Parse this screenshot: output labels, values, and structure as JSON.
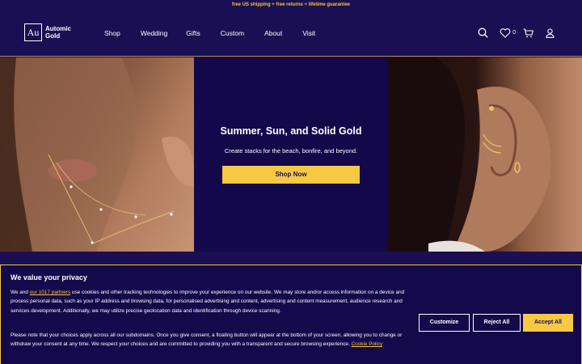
{
  "promo": {
    "text": "free US shipping + free returns + lifetime guarantee"
  },
  "header": {
    "logo_mark": "Au",
    "logo_line1": "Automic",
    "logo_line2": "Gold",
    "nav": [
      "Shop",
      "Wedding",
      "Gifts",
      "Custom",
      "About",
      "Visit"
    ],
    "wishlist_count": "0",
    "icons": [
      "search-icon",
      "heart-icon",
      "cart-icon",
      "user-icon"
    ]
  },
  "hero": {
    "title": "Summer, Sun, and Solid Gold",
    "subtitle": "Create stacks for the beach, bonfire, and beyond.",
    "cta": "Shop Now"
  },
  "cookie": {
    "title": "We value your privacy",
    "p1_prefix": "We and ",
    "partners_link": "our 1017 partners",
    "p1_rest": " use cookies and other tracking technologies to improve your experience on our website. We may store and/or access information on a device and process personal data, such as your IP address and browsing data, for personalised advertising and content, advertising and content measurement, audience research and services development. Additionally, we may utilize precise geolocation data and identification through device scanning.",
    "p2": "Please note that your choices apply across all our subdomains. Once you give consent, a floating button will appear at the bottom of your screen, allowing you to change or withdraw your consent at any time. We respect your choices and are committed to providing you with a transparent and secure browsing experience. ",
    "policy_link": "Cookie Policy",
    "btn_customize": "Customize",
    "btn_reject": "Reject All",
    "btn_accept": "Accept All"
  },
  "colors": {
    "brand_navy": "#1a0f52",
    "accent_gold": "#f7c843"
  }
}
